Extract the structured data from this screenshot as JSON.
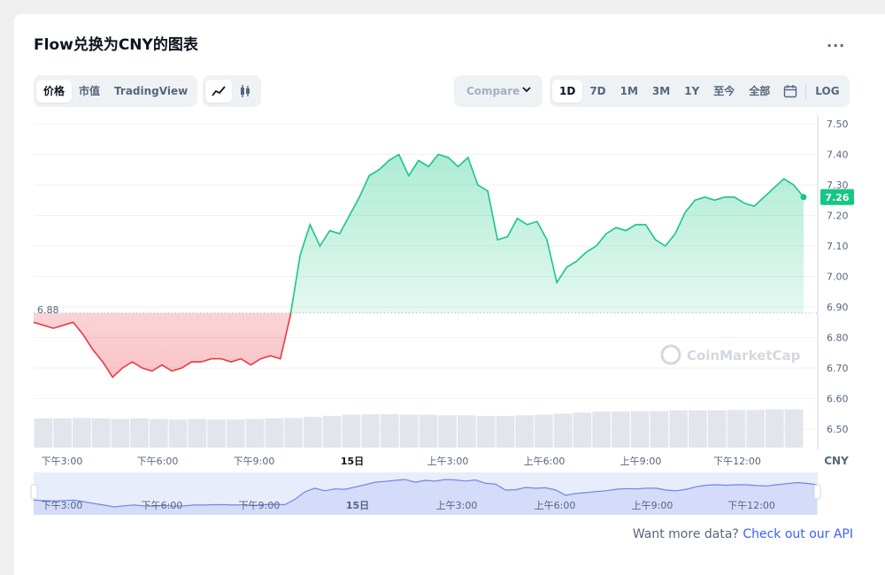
{
  "title": "Flow兑换为CNY的图表",
  "more_label": "...",
  "view_tabs": [
    {
      "label": "价格",
      "active": true
    },
    {
      "label": "市值",
      "active": false
    },
    {
      "label": "TradingView",
      "active": false
    }
  ],
  "chart_type_icons": [
    "line-chart-icon",
    "candlestick-icon"
  ],
  "compare_label": "Compare",
  "range_tabs": [
    {
      "label": "1D",
      "active": true
    },
    {
      "label": "7D",
      "active": false
    },
    {
      "label": "1M",
      "active": false
    },
    {
      "label": "3M",
      "active": false
    },
    {
      "label": "1Y",
      "active": false
    },
    {
      "label": "至今",
      "active": false
    },
    {
      "label": "全部",
      "active": false
    }
  ],
  "log_label": "LOG",
  "watermark": "CoinMarketCap",
  "footer": {
    "text": "Want more data?",
    "link": "Check out our API"
  },
  "colors": {
    "up": "#16c784",
    "down": "#ea3943",
    "accent": "#3861fb"
  },
  "chart_data": {
    "type": "area",
    "currency": "CNY",
    "y_ticks": [
      "7.50",
      "7.40",
      "7.30",
      "7.20",
      "7.10",
      "7.00",
      "6.90",
      "6.80",
      "6.70",
      "6.60",
      "6.50"
    ],
    "ylim": [
      6.45,
      7.52
    ],
    "x_tick_labels": [
      "下午3:00",
      "下午6:00",
      "下午9:00",
      "15日",
      "上午3:00",
      "上午6:00",
      "上午9:00",
      "下午12:00"
    ],
    "reference_price": "6.88",
    "current_price": "7.26",
    "series": [
      {
        "values": [
          6.85,
          6.84,
          6.83,
          6.84,
          6.85,
          6.81,
          6.76,
          6.72,
          6.67,
          6.7,
          6.72,
          6.7,
          6.69,
          6.71,
          6.69,
          6.7,
          6.72,
          6.72,
          6.73,
          6.73,
          6.72,
          6.73,
          6.71,
          6.73,
          6.74,
          6.73,
          6.87,
          7.07,
          7.17,
          7.1,
          7.15,
          7.14,
          7.2,
          7.26,
          7.33,
          7.35,
          7.38,
          7.4,
          7.33,
          7.38,
          7.36,
          7.4,
          7.39,
          7.36,
          7.39,
          7.3,
          7.28,
          7.12,
          7.13,
          7.19,
          7.17,
          7.18,
          7.12,
          6.98,
          7.03,
          7.05,
          7.08,
          7.1,
          7.14,
          7.16,
          7.15,
          7.17,
          7.17,
          7.12,
          7.1,
          7.14,
          7.21,
          7.25,
          7.26,
          7.25,
          7.26,
          7.26,
          7.24,
          7.23,
          7.26,
          7.29,
          7.32,
          7.3,
          7.26
        ]
      }
    ],
    "volume_fraction": [
      0.55,
      0.55,
      0.56,
      0.55,
      0.54,
      0.55,
      0.54,
      0.53,
      0.54,
      0.53,
      0.53,
      0.54,
      0.55,
      0.56,
      0.58,
      0.6,
      0.62,
      0.63,
      0.63,
      0.62,
      0.62,
      0.61,
      0.61,
      0.6,
      0.6,
      0.61,
      0.62,
      0.64,
      0.66,
      0.68,
      0.68,
      0.69,
      0.69,
      0.7,
      0.7,
      0.7,
      0.71,
      0.71,
      0.72,
      0.72
    ]
  }
}
